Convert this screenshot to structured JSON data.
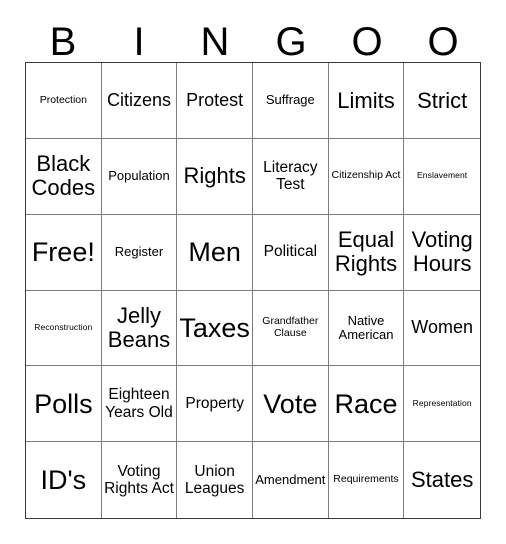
{
  "card": {
    "header_letters": [
      "B",
      "I",
      "N",
      "G",
      "O",
      "O"
    ],
    "columns": 6,
    "rows": 6,
    "colors": {
      "background": "#ffffff",
      "text": "#000000",
      "grid_line": "#7d7d7d",
      "outer_border": "#3a3a3a"
    },
    "cells": [
      {
        "text": "Protection",
        "size": "s"
      },
      {
        "text": "Citizens",
        "size": "l"
      },
      {
        "text": "Protest",
        "size": "l"
      },
      {
        "text": "Suffrage",
        "size": "m"
      },
      {
        "text": "Limits",
        "size": "xl"
      },
      {
        "text": "Strict",
        "size": "xl"
      },
      {
        "text": "Black Codes",
        "size": "xl"
      },
      {
        "text": "Population",
        "size": "m"
      },
      {
        "text": "Rights",
        "size": "xl"
      },
      {
        "text": "Literacy Test",
        "size": "ml"
      },
      {
        "text": "Citizenship Act",
        "size": "s"
      },
      {
        "text": "Enslavement",
        "size": "xs"
      },
      {
        "text": "Free!",
        "size": "xxl"
      },
      {
        "text": "Register",
        "size": "m"
      },
      {
        "text": "Men",
        "size": "xxl"
      },
      {
        "text": "Political",
        "size": "ml"
      },
      {
        "text": "Equal Rights",
        "size": "xl"
      },
      {
        "text": "Voting Hours",
        "size": "xl"
      },
      {
        "text": "Reconstruction",
        "size": "xs"
      },
      {
        "text": "Jelly Beans",
        "size": "xl"
      },
      {
        "text": "Taxes",
        "size": "xxl"
      },
      {
        "text": "Grandfather Clause",
        "size": "s"
      },
      {
        "text": "Native American",
        "size": "m"
      },
      {
        "text": "Women",
        "size": "l"
      },
      {
        "text": "Polls",
        "size": "xxl"
      },
      {
        "text": "Eighteen Years Old",
        "size": "ml"
      },
      {
        "text": "Property",
        "size": "ml"
      },
      {
        "text": "Vote",
        "size": "xxl"
      },
      {
        "text": "Race",
        "size": "xxl"
      },
      {
        "text": "Representation",
        "size": "xs"
      },
      {
        "text": "ID's",
        "size": "xxl"
      },
      {
        "text": "Voting Rights Act",
        "size": "ml"
      },
      {
        "text": "Union Leagues",
        "size": "ml"
      },
      {
        "text": "Amendment",
        "size": "m"
      },
      {
        "text": "Requirements",
        "size": "s"
      },
      {
        "text": "States",
        "size": "xl"
      }
    ]
  }
}
